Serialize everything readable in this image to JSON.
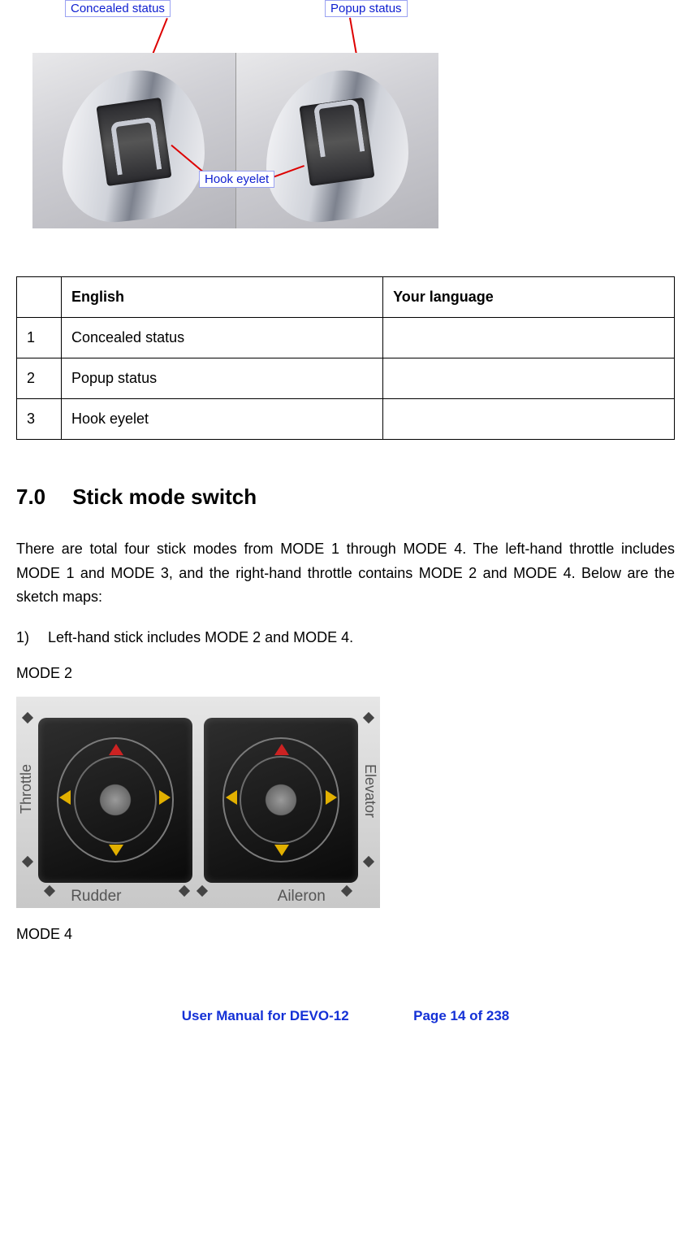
{
  "figure": {
    "callouts": {
      "concealed": "Concealed status",
      "popup": "Popup status",
      "hook": "Hook eyelet"
    }
  },
  "termsTable": {
    "headers": {
      "english": "English",
      "yourlang": "Your language"
    },
    "rows": [
      {
        "num": "1",
        "english": "Concealed status",
        "yourlang": ""
      },
      {
        "num": "2",
        "english": "Popup status",
        "yourlang": ""
      },
      {
        "num": "3",
        "english": "Hook eyelet",
        "yourlang": ""
      }
    ]
  },
  "section": {
    "number": "7.0",
    "title": "Stick mode switch",
    "intro": "There are total four stick modes from MODE 1 through MODE 4. The left-hand throttle includes MODE 1 and MODE 3, and the right-hand throttle contains MODE 2 and MODE 4. Below are the sketch maps:",
    "item1_num": "1)",
    "item1_text": "Left-hand stick includes MODE 2 and MODE 4.",
    "mode2_label": "MODE 2",
    "mode4_label": "MODE 4"
  },
  "modeFigure": {
    "leftAxisV": "Throttle",
    "rightAxisV": "Elevator",
    "leftAxisH": "Rudder",
    "rightAxisH": "Aileron"
  },
  "footer": {
    "product": "User Manual for DEVO-12",
    "page": "Page 14 of 238"
  }
}
